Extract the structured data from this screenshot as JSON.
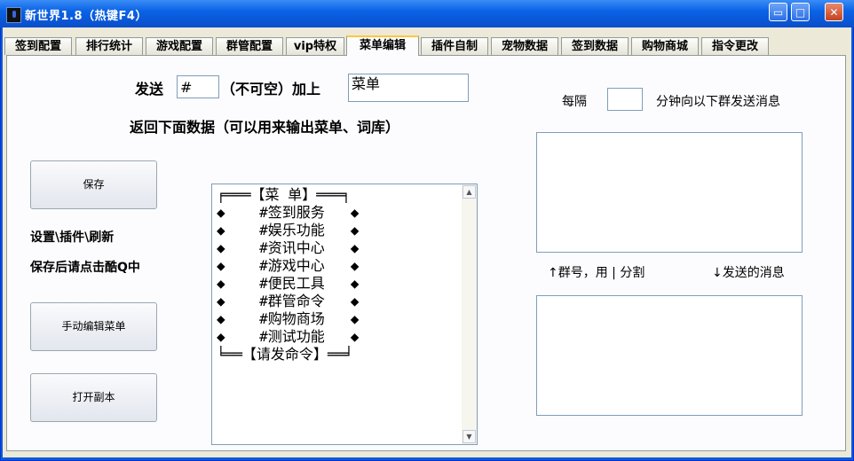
{
  "window": {
    "title": "新世界1.8（热键F4）",
    "controls": {
      "minimize": "▭",
      "maximize": "□",
      "close": "✕"
    }
  },
  "tabs": [
    {
      "label": "签到配置"
    },
    {
      "label": "排行统计"
    },
    {
      "label": "游戏配置"
    },
    {
      "label": "群管配置"
    },
    {
      "label": "vip特权"
    },
    {
      "label": "菜单编辑",
      "active": true
    },
    {
      "label": "插件自制"
    },
    {
      "label": "宠物数据"
    },
    {
      "label": "签到数据"
    },
    {
      "label": "购物商城"
    },
    {
      "label": "指令更改"
    }
  ],
  "menu_edit": {
    "send_label": "发送",
    "trigger_value": "#",
    "not_empty_label": "（不可空）加上",
    "suffix_value": "菜单",
    "return_label": "返回下面数据（可以用来输出菜单、词库）",
    "save_button": "保存",
    "note_line1": "设置\\插件\\刷新",
    "note_line2": "保存后请点击酷Q中",
    "manual_edit_button": "手动编辑菜单",
    "open_copy_button": "打开副本",
    "menu_content": "╒═══【菜 单】═══╕\n◆    #签到服务   ◆\n◆    #娱乐功能   ◆\n◆    #资讯中心   ◆\n◆    #游戏中心   ◆\n◆    #便民工具   ◆\n◆    #群管命令   ◆\n◆    #购物商场   ◆\n◆    #测试功能   ◆\n╘══【请发命令】══╛"
  },
  "scheduled": {
    "every_label": "每隔",
    "minutes_value": "",
    "after_label": "分钟向以下群发送消息",
    "groups_hint": "↑群号，用 | 分割",
    "message_hint": "↓发送的消息"
  }
}
